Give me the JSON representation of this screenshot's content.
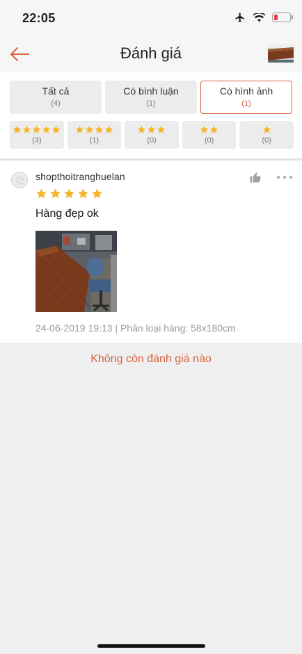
{
  "status": {
    "time": "22:05"
  },
  "header": {
    "title": "Đánh giá"
  },
  "filters": [
    {
      "label": "Tất cả",
      "count": "(4)"
    },
    {
      "label": "Có bình luận",
      "count": "(1)"
    },
    {
      "label": "Có hình ảnh",
      "count": "(1)"
    }
  ],
  "star_filters": [
    {
      "stars": 5,
      "count": "(3)"
    },
    {
      "stars": 4,
      "count": "(1)"
    },
    {
      "stars": 3,
      "count": "(0)"
    },
    {
      "stars": 2,
      "count": "(0)"
    },
    {
      "stars": 1,
      "count": "(0)"
    }
  ],
  "review": {
    "username": "shopthoitranghuelan",
    "rating": 5,
    "text": "Hàng đẹp ok",
    "meta": "24-06-2019 19:13 | Phân loại hàng: 58x180cm"
  },
  "end_message": "Không còn đánh giá nào",
  "colors": {
    "accent": "#d9603e",
    "star": "#f6b52b"
  }
}
